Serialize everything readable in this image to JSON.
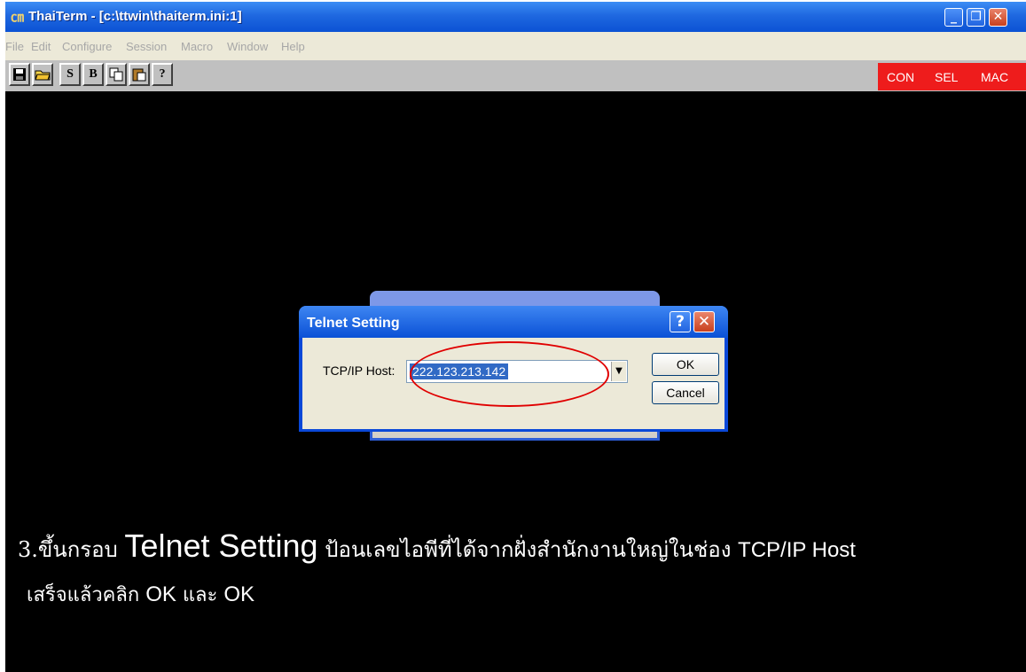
{
  "window": {
    "title": "ThaiTerm - [c:\\ttwin\\thaiterm.ini:1]",
    "icon": "thaiterm-app-icon",
    "controls": {
      "minimize": "_",
      "maximize": "❐",
      "close": "✕"
    }
  },
  "menu": [
    "File",
    "Edit",
    "Configure",
    "Session",
    "Macro",
    "Window",
    "Help"
  ],
  "toolbar": {
    "buttons": [
      {
        "name": "save",
        "icon": "floppy-icon",
        "glyph": "▪"
      },
      {
        "name": "open",
        "icon": "folder-icon",
        "glyph": "▰"
      },
      {
        "name": "s",
        "glyph": "S"
      },
      {
        "name": "b",
        "glyph": "B"
      },
      {
        "name": "copy",
        "icon": "copy-icon",
        "glyph": "⧉"
      },
      {
        "name": "paste",
        "icon": "paste-icon",
        "glyph": "▣"
      },
      {
        "name": "help",
        "icon": "help-icon",
        "glyph": "?"
      }
    ],
    "status": [
      "CON",
      "SEL",
      "MAC"
    ],
    "status_color": "#ee1c1c"
  },
  "dialog": {
    "title": "Telnet  Setting",
    "help_glyph": "?",
    "close_glyph": "✕",
    "host_label": "TCP/IP Host:",
    "host_value": "222.123.213.142",
    "combo_arrow": "▼",
    "ok_label": "OK",
    "cancel_label": "Cancel"
  },
  "instructions": {
    "line1_prefix": "3.ขึ้นกรอบ ",
    "line1_big": "Telnet Setting",
    "line1_middle": " ป้อนเลขไอพีที่ได้จากฝั่งสำนักงานใหญ่ในช่อง ",
    "line1_tail": "TCP/IP Host",
    "line2_prefix": "เสร็จแล้วคลิก ",
    "line2_ok1": "OK",
    "line2_and": " และ ",
    "line2_ok2": "OK"
  },
  "colors": {
    "title_bar": "#0b52d4",
    "terminal_bg": "#000000",
    "selection": "#316ac5",
    "annotation": "#e00000"
  }
}
